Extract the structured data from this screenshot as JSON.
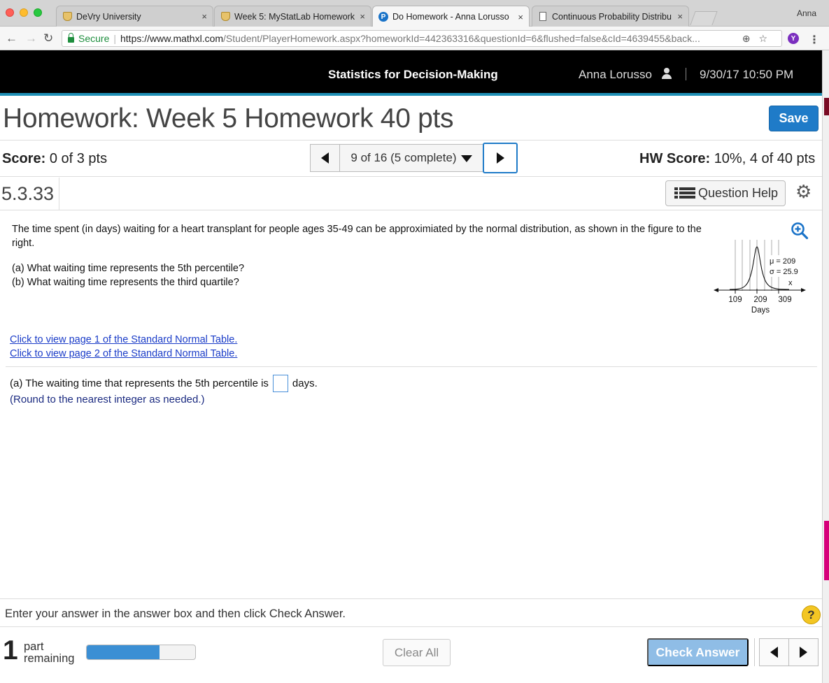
{
  "browser": {
    "tabs": [
      {
        "title": "DeVry University",
        "icon": "shield-icon",
        "active": false
      },
      {
        "title": "Week 5: MyStatLab Homework",
        "icon": "shield-icon",
        "active": false
      },
      {
        "title": "Do Homework - Anna Lorusso",
        "icon": "pearson-icon",
        "active": true
      },
      {
        "title": "Continuous Probability Distribu",
        "icon": "document-icon",
        "active": false
      }
    ],
    "close_glyph": "×",
    "profile": "Anna",
    "secure_label": "Secure",
    "url_host": "https://www.mathxl.com",
    "url_path": "/Student/PlayerHomework.aspx?homeworkId=442363316&questionId=6&flushed=false&cId=4639455&back...",
    "extension_letter": "Y"
  },
  "header": {
    "course": "Statistics for Decision-Making",
    "user": "Anna Lorusso",
    "datetime": "9/30/17 10:50 PM"
  },
  "homework": {
    "title": "Homework: Week 5 Homework 40 pts",
    "save_label": "Save"
  },
  "score": {
    "label": "Score:",
    "value": "0 of 3 pts",
    "hw_label": "HW Score:",
    "hw_value": "10%, 4 of 40 pts"
  },
  "navigation": {
    "selector": "9 of 16 (5 complete)"
  },
  "question": {
    "id": "5.3.33",
    "help_label": "Question Help",
    "text": "The time spent (in days) waiting for a heart transplant for people ages 35-49 can be approximiated by the normal distribution, as shown in the figure to the right.",
    "part_a": "(a) What waiting time represents the 5th percentile?",
    "part_b": "(b) What waiting time represents the third quartile?",
    "figure": {
      "mu_label": "μ = 209",
      "sigma_label": "σ = 25.9",
      "x_label": "x",
      "ticks": [
        "109",
        "209",
        "309"
      ],
      "axis_label": "Days"
    },
    "links": [
      "Click to view page 1 of the Standard Normal Table.",
      "Click to view page 2 of the Standard Normal Table."
    ],
    "answer_prefix": "(a) The waiting time that represents the 5th percentile is",
    "answer_suffix": "days.",
    "answer_value": "",
    "round_note": "(Round to the nearest integer as needed.)"
  },
  "footer": {
    "instructions": "Enter your answer in the answer box and then click Check Answer.",
    "help_glyph": "?",
    "parts_count": "1",
    "parts_line1": "part",
    "parts_line2": "remaining",
    "progress_fraction": 0.67,
    "clear_label": "Clear All",
    "check_label": "Check Answer"
  },
  "colors": {
    "accent": "#1f8fb5",
    "save_button": "#1f7bc8",
    "check_button_disabled": "#8fbde6",
    "link": "#1a3cc8",
    "progress_fill": "#3b8fd4"
  }
}
